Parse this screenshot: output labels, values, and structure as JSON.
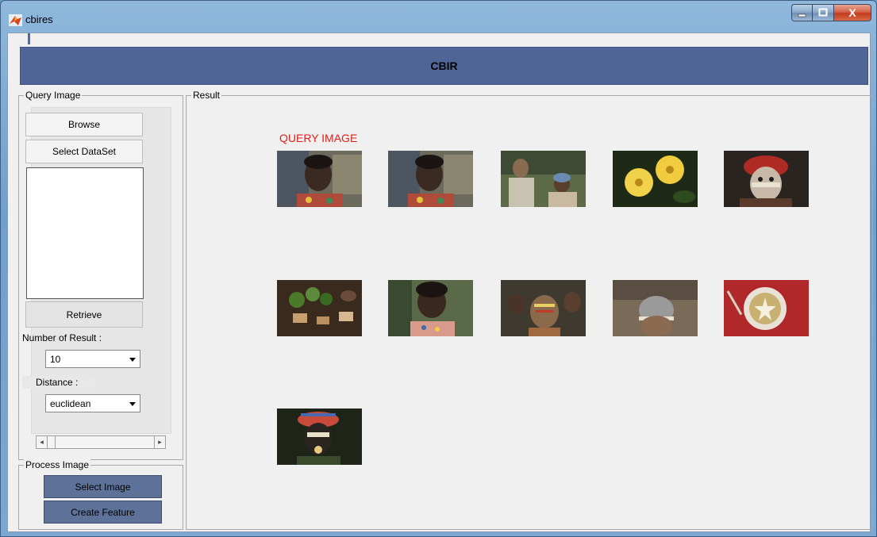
{
  "window": {
    "title": "cbires",
    "minimize_icon": "minimize-icon",
    "maximize_icon": "maximize-icon",
    "close_icon": "close-icon",
    "close_glyph": "X"
  },
  "header": {
    "title": "CBIR"
  },
  "query_panel": {
    "label": "Query Image",
    "browse_label": "Browse",
    "dataset_label": "Select DataSet",
    "retrieve_label": "Retrieve",
    "num_result_label": "Number of Result :",
    "num_result_value": "10",
    "distance_label": "Distance :",
    "distance_value": "euclidean",
    "scroll_left": "◂",
    "scroll_right": "▸"
  },
  "process_panel": {
    "label": "Process Image",
    "select_image_label": "Select Image",
    "create_feature_label": "Create Feature"
  },
  "result_panel": {
    "label": "Result",
    "query_image_label": "QUERY IMAGE",
    "images": [
      "woman-portrait",
      "woman-portrait-match",
      "two-men-seated",
      "yellow-flowers",
      "painted-face-warrior",
      "market-vegetables",
      "woman-downcast",
      "painted-woman-crowd",
      "elder-headband",
      "soup-bowl",
      "feathered-headdress-man"
    ]
  },
  "colors": {
    "header": "#4f6597",
    "process_buttons": "#5d7199",
    "query_label": "#e0201b"
  }
}
